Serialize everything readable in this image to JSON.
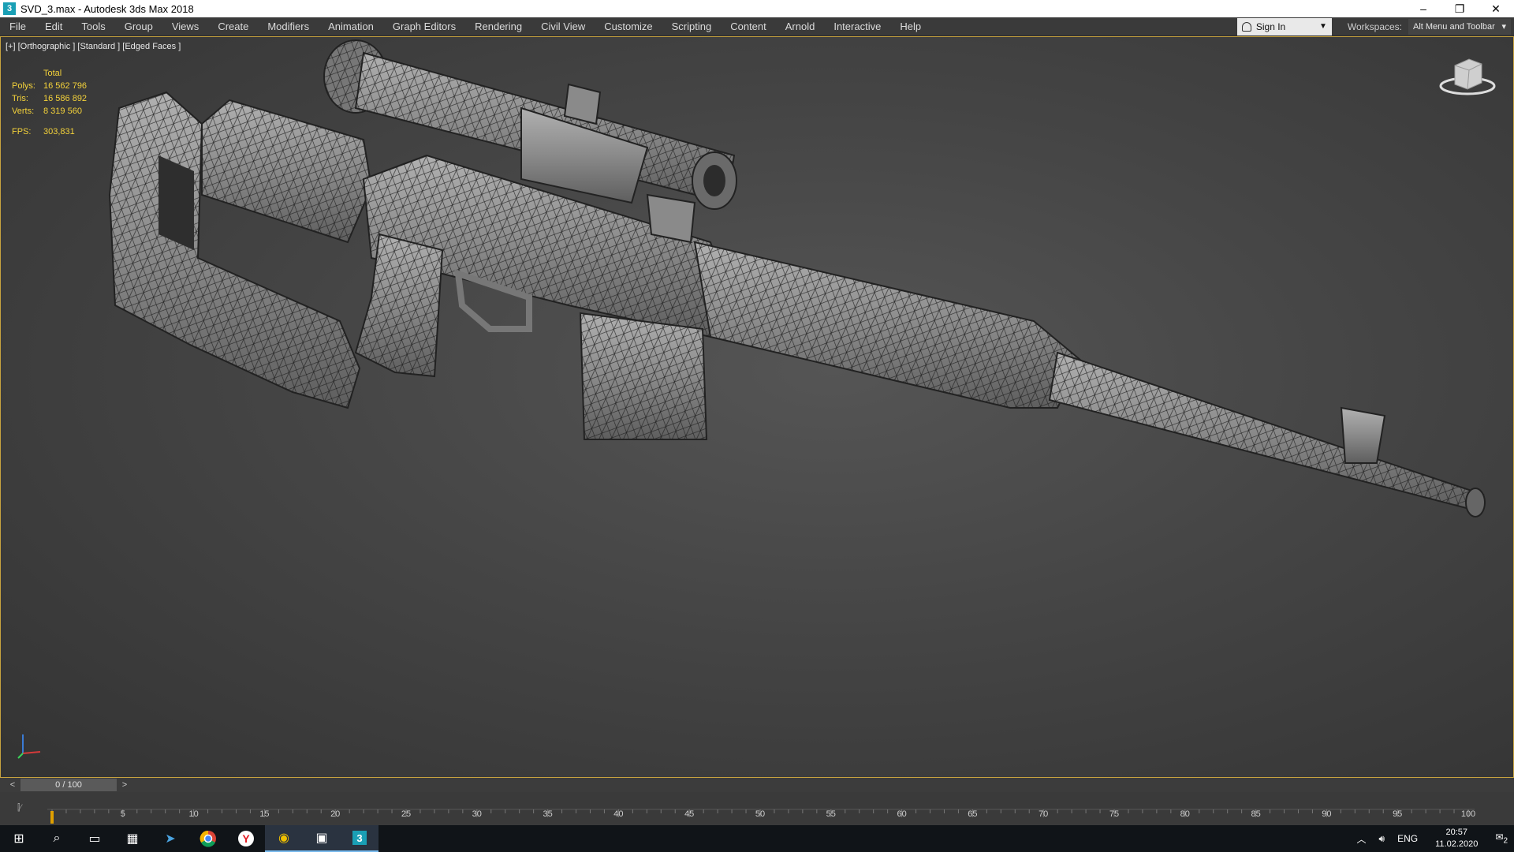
{
  "window": {
    "title": "SVD_3.max - Autodesk 3ds Max 2018",
    "app_icon_glyph": "3",
    "controls": [
      "–",
      "❐",
      "✕"
    ]
  },
  "menubar": {
    "items": [
      "File",
      "Edit",
      "Tools",
      "Group",
      "Views",
      "Create",
      "Modifiers",
      "Animation",
      "Graph Editors",
      "Rendering",
      "Civil View",
      "Customize",
      "Scripting",
      "Content",
      "Arnold",
      "Interactive",
      "Help"
    ],
    "sign_in": "Sign In",
    "workspaces_label": "Workspaces:",
    "workspaces_value": "Alt Menu and Toolbar"
  },
  "viewport": {
    "label": "[+] [Orthographic ] [Standard ] [Edged Faces ]",
    "stats": {
      "header": "Total",
      "polys_label": "Polys:",
      "polys": "16 562 796",
      "tris_label": "Tris:",
      "tris": "16 586 892",
      "verts_label": "Verts:",
      "verts": "8 319 560",
      "fps_label": "FPS:",
      "fps": "303,831"
    },
    "model_subject": "SVD sniper rifle wireframe mesh"
  },
  "timeline": {
    "slider_text": "0 / 100",
    "prev": "<",
    "next": ">",
    "ticks": [
      "5",
      "10",
      "15",
      "20",
      "25",
      "30",
      "35",
      "40",
      "45",
      "50",
      "55",
      "60",
      "65",
      "70",
      "75",
      "80",
      "85",
      "90",
      "95",
      "100"
    ]
  },
  "taskbar": {
    "icons": [
      "windows-start-icon",
      "search-icon",
      "task-view-icon",
      "calculator-icon",
      "send-icon",
      "chrome-icon",
      "yandex-icon",
      "app-icon",
      "photo-icon",
      "3dsmax-icon"
    ],
    "tray": {
      "language": "ENG",
      "time": "20:57",
      "date": "11.02.2020",
      "notifications": "2"
    }
  },
  "colors": {
    "accent": "#c7a33f",
    "stats": "#f4d23a",
    "viewport": "#454545"
  }
}
